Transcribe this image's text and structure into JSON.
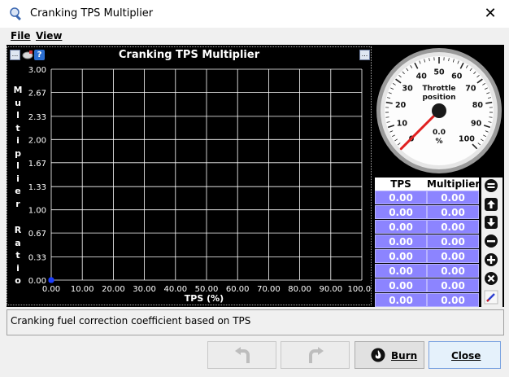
{
  "window": {
    "title": "Cranking TPS Multiplier",
    "close_glyph": "✕"
  },
  "menu": {
    "file": "File",
    "view": "View"
  },
  "chart_panel": {
    "help_glyph": "?",
    "menu_glyph": "..."
  },
  "chart_data": {
    "type": "line",
    "title": "Cranking TPS Multiplier",
    "xlabel": "TPS (%)",
    "ylabel": "Multiplier Ratio",
    "x_ticks": [
      "0.00",
      "10.00",
      "20.00",
      "30.00",
      "40.00",
      "50.00",
      "60.00",
      "70.00",
      "80.00",
      "90.00",
      "100.00"
    ],
    "y_ticks": [
      "0.00",
      "0.33",
      "0.67",
      "1.00",
      "1.33",
      "1.67",
      "2.00",
      "2.33",
      "2.67",
      "3.00"
    ],
    "xlim": [
      0,
      100
    ],
    "ylim": [
      0,
      3
    ],
    "series": [
      {
        "x": [
          0,
          0,
          0,
          0,
          0,
          0,
          0,
          0
        ],
        "y": [
          0,
          0,
          0,
          0,
          0,
          0,
          0,
          0
        ]
      }
    ],
    "grid": true
  },
  "gauge": {
    "label_line1": "Throttle",
    "label_line2": "position",
    "value": "0.0",
    "unit": "%",
    "min": 0,
    "max": 100,
    "ticks": [
      "0",
      "10",
      "20",
      "30",
      "40",
      "50",
      "60",
      "70",
      "80",
      "90",
      "100"
    ],
    "needle_value": 0
  },
  "table": {
    "headers": [
      "TPS",
      "Multiplier"
    ],
    "rows": [
      [
        "0.00",
        "0.00"
      ],
      [
        "0.00",
        "0.00"
      ],
      [
        "0.00",
        "0.00"
      ],
      [
        "0.00",
        "0.00"
      ],
      [
        "0.00",
        "0.00"
      ],
      [
        "0.00",
        "0.00"
      ],
      [
        "0.00",
        "0.00"
      ],
      [
        "0.00",
        "0.00"
      ]
    ]
  },
  "description": "Cranking fuel correction coefficient based on TPS",
  "buttons": {
    "burn": "Burn",
    "close": "Close"
  },
  "colors": {
    "cell_bg": "#8c84ff",
    "point": "#1a3cff",
    "needle": "#e02020"
  }
}
